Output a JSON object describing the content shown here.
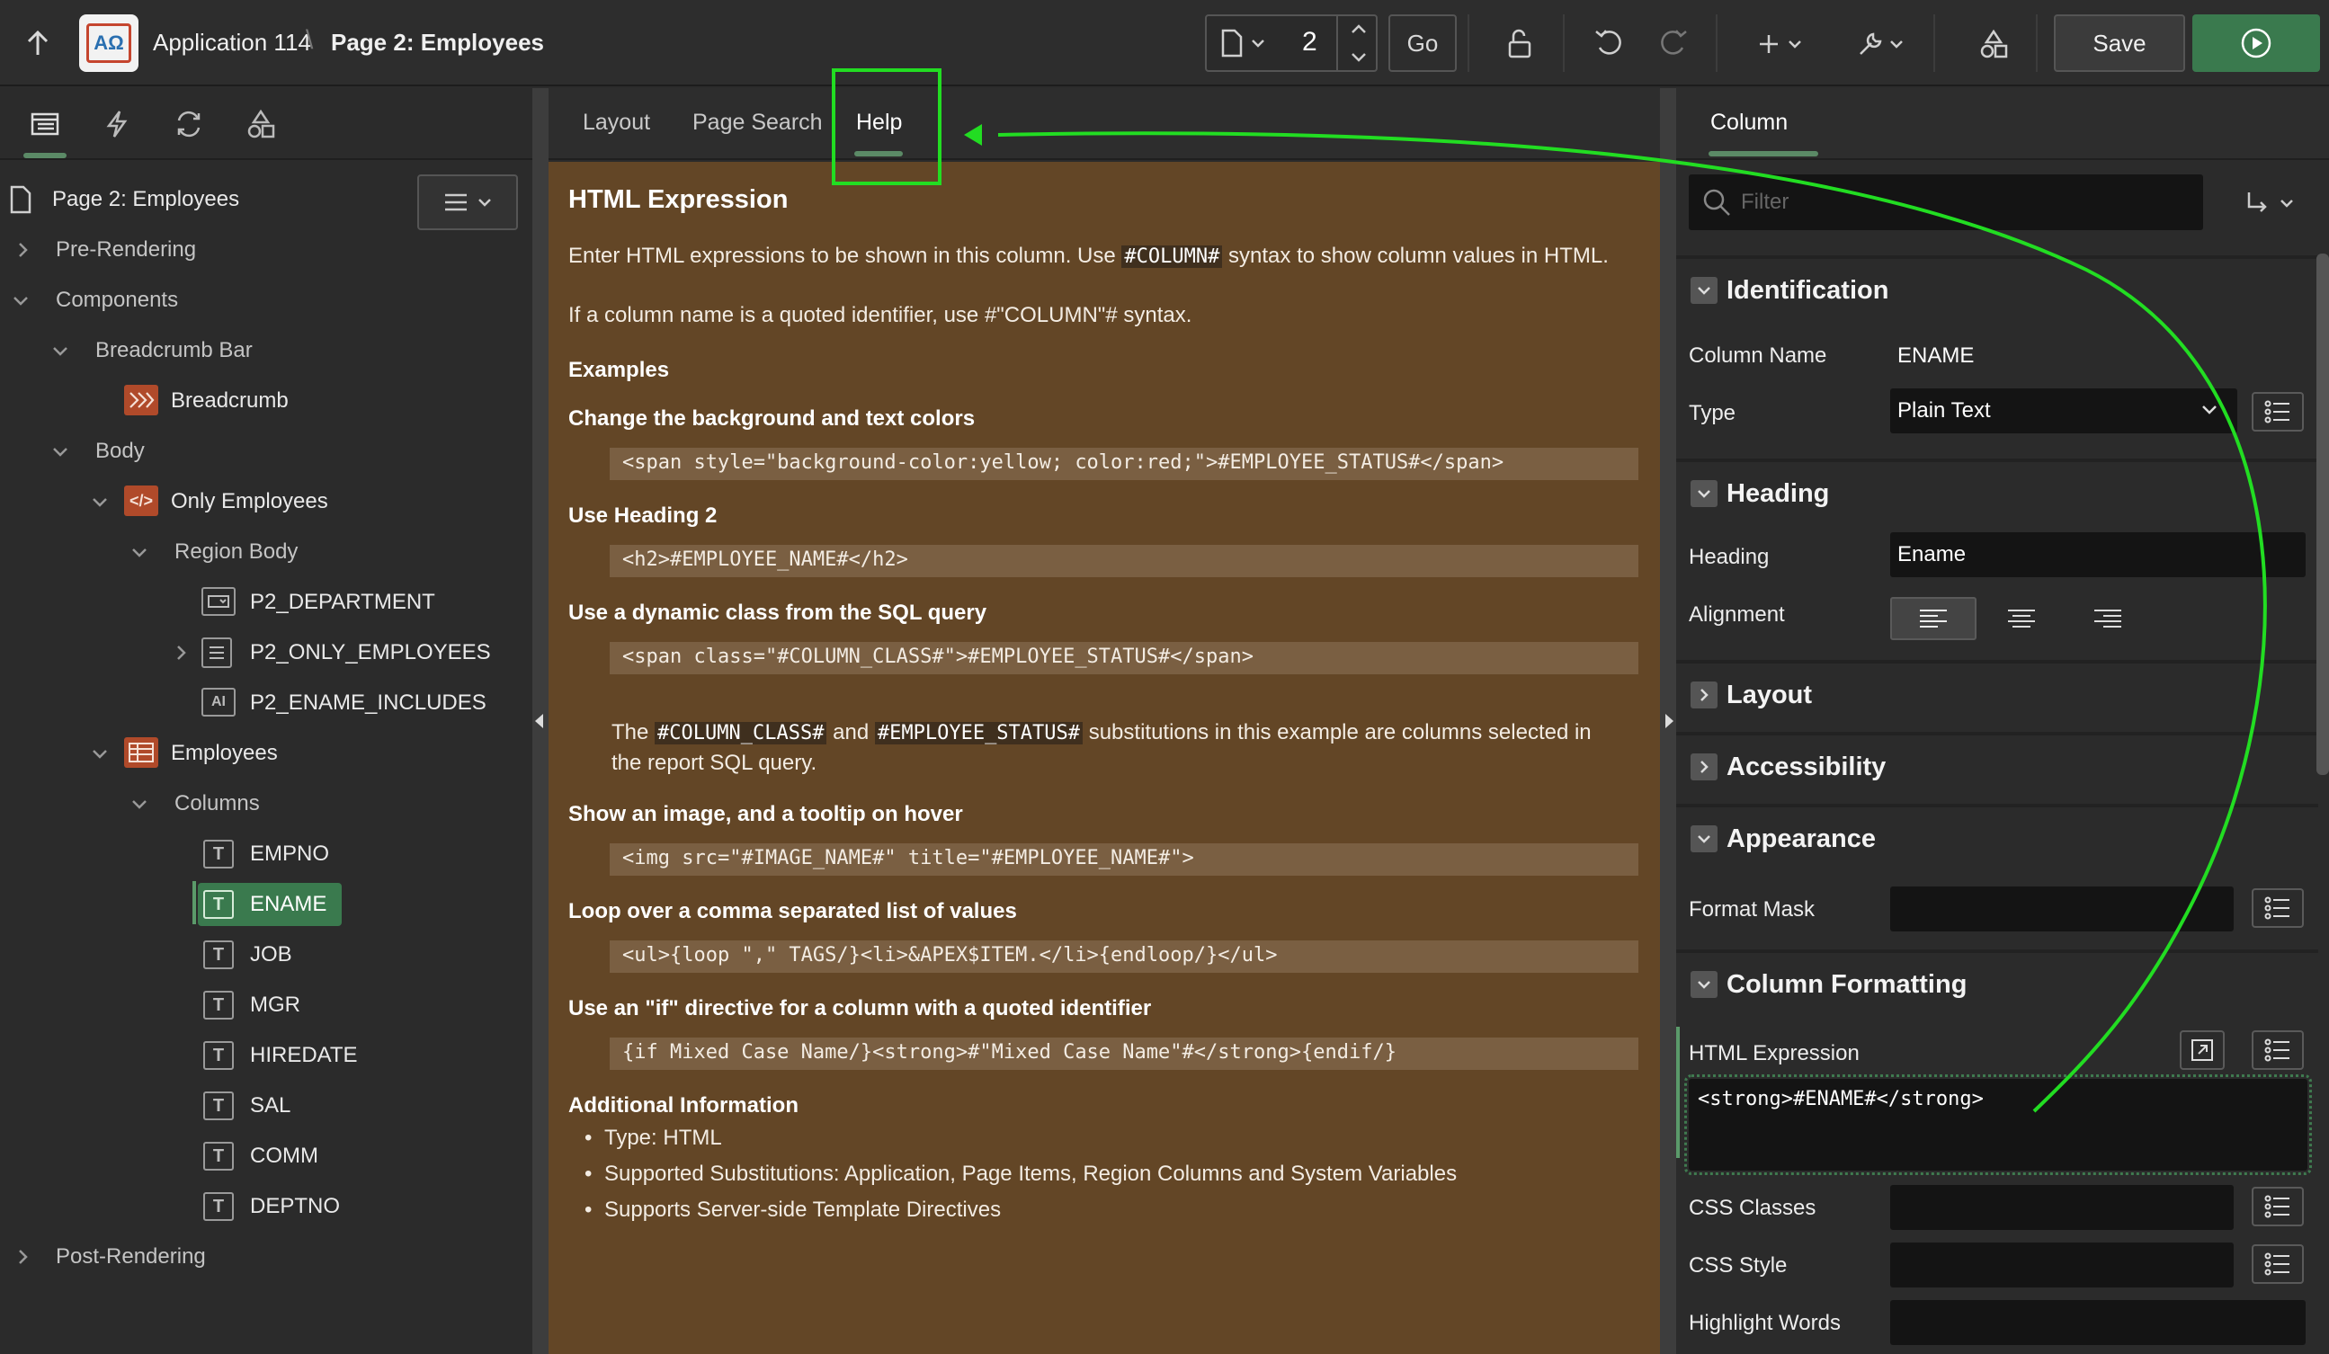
{
  "topbar": {
    "app_title": "Application 114",
    "page_title": "Page 2: Employees",
    "page_number": "2",
    "go_label": "Go",
    "save_label": "Save"
  },
  "tree": {
    "root": "Page 2: Employees",
    "pre_rendering": "Pre-Rendering",
    "components": "Components",
    "breadcrumb_bar": "Breadcrumb Bar",
    "breadcrumb": "Breadcrumb",
    "body": "Body",
    "only_employees": "Only Employees",
    "region_body": "Region Body",
    "p2_department": "P2_DEPARTMENT",
    "p2_only_employees": "P2_ONLY_EMPLOYEES",
    "p2_ename_includes": "P2_ENAME_INCLUDES",
    "employees": "Employees",
    "columns": "Columns",
    "cols": [
      "EMPNO",
      "ENAME",
      "JOB",
      "MGR",
      "HIREDATE",
      "SAL",
      "COMM",
      "DEPTNO"
    ],
    "post_rendering": "Post-Rendering"
  },
  "mid_tabs": [
    "Layout",
    "Page Search",
    "Help"
  ],
  "help": {
    "title": "HTML Expression",
    "intro_a": "Enter HTML expressions to be shown in this column. Use",
    "intro_chip": "#COLUMN#",
    "intro_b": "syntax to show column values in HTML.",
    "quoted": "If a column name is a quoted identifier, use #\"COLUMN\"# syntax.",
    "examples": "Examples",
    "ex1_title": "Change the background and text colors",
    "ex1_code": "<span style=\"background-color:yellow; color:red;\">#EMPLOYEE_STATUS#</span>",
    "ex2_title": "Use Heading 2",
    "ex2_code": "<h2>#EMPLOYEE_NAME#</h2>",
    "ex3_title": "Use a dynamic class from the SQL query",
    "ex3_code": "<span class=\"#COLUMN_CLASS#\">#EMPLOYEE_STATUS#</span>",
    "ex3_note_a": "The",
    "ex3_chip1": "#COLUMN_CLASS#",
    "ex3_note_b": "and",
    "ex3_chip2": "#EMPLOYEE_STATUS#",
    "ex3_note_c": "substitutions in this example are columns selected in",
    "ex3_note_d": "the report SQL query.",
    "ex4_title": "Show an image, and a tooltip on hover",
    "ex4_code": "<img src=\"#IMAGE_NAME#\" title=\"#EMPLOYEE_NAME#\">",
    "ex5_title": "Loop over a comma separated list of values",
    "ex5_code": "<ul>{loop \",\" TAGS/}<li>&APEX$ITEM.</li>{endloop/}</ul>",
    "ex6_title": "Use an \"if\" directive for a column with a quoted identifier",
    "ex6_code": "{if Mixed Case Name/}<strong>#\"Mixed Case Name\"#</strong>{endif/}",
    "additional": "Additional Information",
    "bullets": [
      "Type: HTML",
      "Supported Substitutions: Application, Page Items, Region Columns and System Variables",
      "Supports Server-side Template Directives"
    ]
  },
  "right": {
    "tab": "Column",
    "filter_placeholder": "Filter",
    "identification": "Identification",
    "column_name_label": "Column Name",
    "column_name_value": "ENAME",
    "type_label": "Type",
    "type_value": "Plain Text",
    "heading_section": "Heading",
    "heading_label": "Heading",
    "heading_value": "Ename",
    "alignment_label": "Alignment",
    "layout": "Layout",
    "accessibility": "Accessibility",
    "appearance": "Appearance",
    "format_mask_label": "Format Mask",
    "column_formatting": "Column Formatting",
    "html_expression_label": "HTML Expression",
    "html_expression_value": "<strong>#ENAME#</strong>",
    "css_classes_label": "CSS Classes",
    "css_style_label": "CSS Style",
    "highlight_words_label": "Highlight Words"
  },
  "colors": {
    "accent_green": "#3a7a4e",
    "help_bg": "#634626",
    "annotation_green": "#22dd22"
  }
}
